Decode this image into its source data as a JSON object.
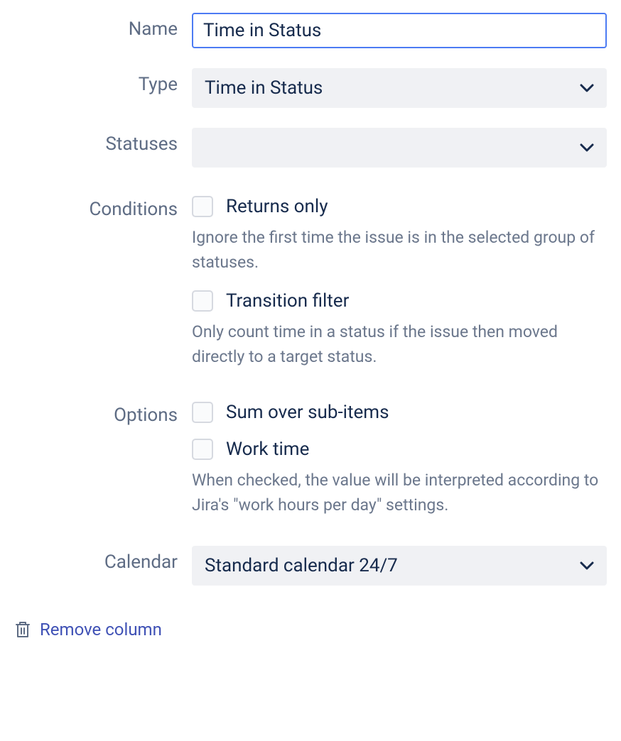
{
  "labels": {
    "name": "Name",
    "type": "Type",
    "statuses": "Statuses",
    "conditions": "Conditions",
    "options": "Options",
    "calendar": "Calendar"
  },
  "fields": {
    "name_value": "Time in Status",
    "type_value": "Time in Status",
    "statuses_value": "",
    "calendar_value": "Standard calendar 24/7"
  },
  "conditions": {
    "returns_only": {
      "label": "Returns only",
      "help": "Ignore the first time the issue is in the selected group of statuses."
    },
    "transition_filter": {
      "label": "Transition filter",
      "help": "Only count time in a status if the issue then moved directly to a target status."
    }
  },
  "options": {
    "sum_sub_items": {
      "label": "Sum over sub-items"
    },
    "work_time": {
      "label": "Work time",
      "help": "When checked, the value will be interpreted according to Jira's \"work hours per day\" settings."
    }
  },
  "actions": {
    "remove_column": "Remove column"
  }
}
